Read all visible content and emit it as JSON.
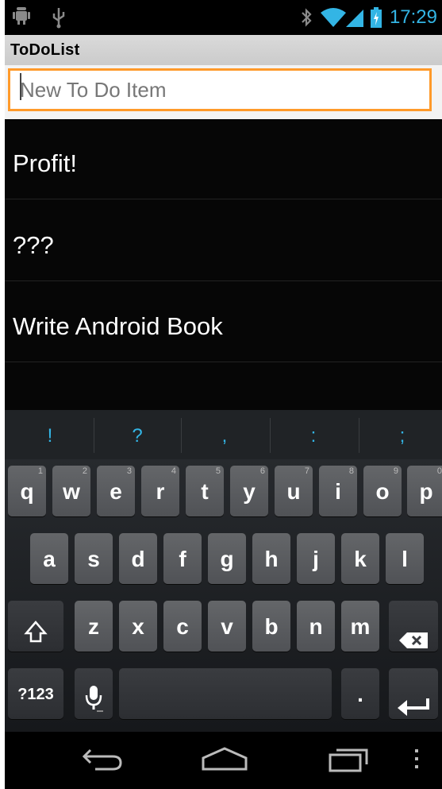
{
  "status_bar": {
    "time": "17:29",
    "icons": [
      "android-debug-icon",
      "usb-icon",
      "bluetooth-icon",
      "wifi-icon",
      "signal-icon",
      "battery-icon"
    ],
    "time_color": "#33b5e5"
  },
  "app": {
    "title": "ToDoList"
  },
  "input": {
    "placeholder": "New To Do Item",
    "value": "",
    "accent_color": "#ff9a2a"
  },
  "todo_items": [
    "Profit!",
    "???",
    "Write Android Book"
  ],
  "keyboard": {
    "suggestions": [
      "!",
      "?",
      ",",
      ":",
      ";"
    ],
    "row1": [
      {
        "label": "q",
        "hint": "1"
      },
      {
        "label": "w",
        "hint": "2"
      },
      {
        "label": "e",
        "hint": "3"
      },
      {
        "label": "r",
        "hint": "4"
      },
      {
        "label": "t",
        "hint": "5"
      },
      {
        "label": "y",
        "hint": "6"
      },
      {
        "label": "u",
        "hint": "7"
      },
      {
        "label": "i",
        "hint": "8"
      },
      {
        "label": "o",
        "hint": "9"
      },
      {
        "label": "p",
        "hint": "0"
      }
    ],
    "row2": [
      "a",
      "s",
      "d",
      "f",
      "g",
      "h",
      "j",
      "k",
      "l"
    ],
    "row3": [
      "z",
      "x",
      "c",
      "v",
      "b",
      "n",
      "m"
    ],
    "symbols_label": "?123",
    "period_label": ".",
    "icons": [
      "shift-icon",
      "backspace-icon",
      "microphone-icon",
      "enter-icon"
    ]
  },
  "nav_bar": {
    "icons": [
      "back-icon",
      "home-icon",
      "recent-apps-icon",
      "menu-icon"
    ]
  }
}
